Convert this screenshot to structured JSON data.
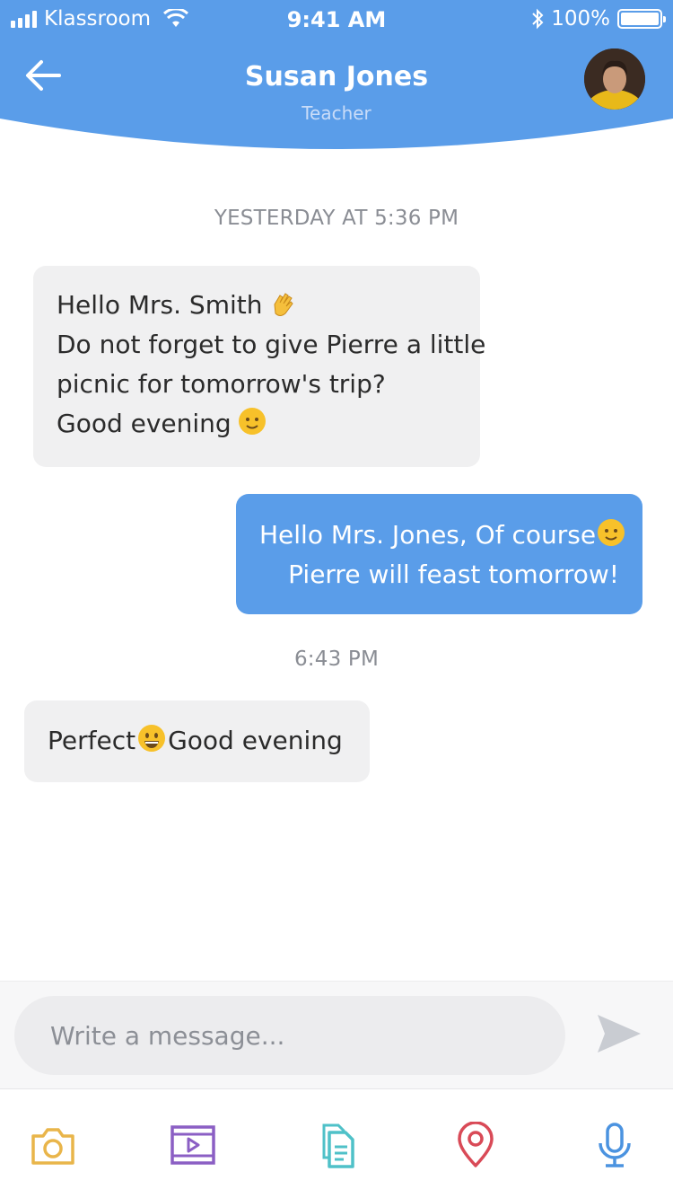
{
  "status_bar": {
    "carrier": "Klassroom",
    "time": "9:41 AM",
    "battery": "100%"
  },
  "header": {
    "name": "Susan Jones",
    "role": "Teacher",
    "accent_color": "#5a9de9"
  },
  "messages": [
    {
      "type": "timestamp",
      "text": "YESTERDAY AT 5:36 PM"
    },
    {
      "type": "incoming",
      "lines": [
        "Hello Mrs. Smith",
        "Do not forget to give Pierre a little",
        "picnic for tomorrow's trip?",
        "Good evening"
      ]
    },
    {
      "type": "outgoing",
      "lines": [
        "Hello Mrs. Jones, Of course",
        "Pierre will feast tomorrow!"
      ]
    },
    {
      "type": "timestamp",
      "text": "6:43 PM"
    },
    {
      "type": "incoming",
      "parts": [
        "Perfect",
        "Good evening"
      ]
    }
  ],
  "composer": {
    "placeholder": "Write a message..."
  },
  "toolbar": {
    "icons": [
      "camera-icon",
      "video-icon",
      "document-icon",
      "location-pin-icon",
      "microphone-icon"
    ],
    "colors": [
      "#e9b54a",
      "#8b5fc4",
      "#4fc1c8",
      "#d94a57",
      "#4b93e0"
    ]
  }
}
